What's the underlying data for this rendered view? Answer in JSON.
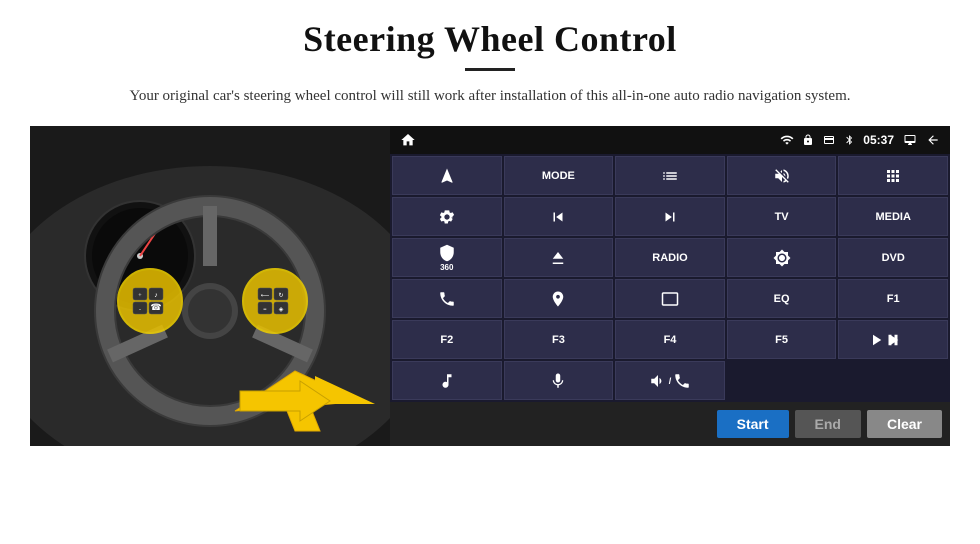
{
  "header": {
    "title": "Steering Wheel Control",
    "subtitle": "Your original car's steering wheel control will still work after installation of this all-in-one auto radio navigation system."
  },
  "status_bar": {
    "time": "05:37",
    "icons": [
      "wifi",
      "lock",
      "card",
      "bluetooth",
      "screen",
      "back"
    ]
  },
  "buttons": [
    {
      "id": "r1c1",
      "type": "icon",
      "icon": "navigate",
      "label": ""
    },
    {
      "id": "r1c2",
      "type": "text",
      "label": "MODE"
    },
    {
      "id": "r1c3",
      "type": "icon",
      "icon": "list",
      "label": ""
    },
    {
      "id": "r1c4",
      "type": "icon",
      "icon": "mute",
      "label": ""
    },
    {
      "id": "r1c5",
      "type": "icon",
      "icon": "apps",
      "label": ""
    },
    {
      "id": "r2c1",
      "type": "icon",
      "icon": "settings",
      "label": ""
    },
    {
      "id": "r2c2",
      "type": "icon",
      "icon": "prev",
      "label": ""
    },
    {
      "id": "r2c3",
      "type": "icon",
      "icon": "next",
      "label": ""
    },
    {
      "id": "r2c4",
      "type": "text",
      "label": "TV"
    },
    {
      "id": "r2c5",
      "type": "text",
      "label": "MEDIA"
    },
    {
      "id": "r3c1",
      "type": "icon",
      "icon": "360cam",
      "label": "360"
    },
    {
      "id": "r3c2",
      "type": "icon",
      "icon": "eject",
      "label": ""
    },
    {
      "id": "r3c3",
      "type": "text",
      "label": "RADIO"
    },
    {
      "id": "r3c4",
      "type": "icon",
      "icon": "brightness",
      "label": ""
    },
    {
      "id": "r3c5",
      "type": "text",
      "label": "DVD"
    },
    {
      "id": "r4c1",
      "type": "icon",
      "icon": "phone",
      "label": ""
    },
    {
      "id": "r4c2",
      "type": "icon",
      "icon": "navi",
      "label": ""
    },
    {
      "id": "r4c3",
      "type": "icon",
      "icon": "screen2",
      "label": ""
    },
    {
      "id": "r4c4",
      "type": "text",
      "label": "EQ"
    },
    {
      "id": "r4c5",
      "type": "text",
      "label": "F1"
    },
    {
      "id": "r5c1",
      "type": "text",
      "label": "F2"
    },
    {
      "id": "r5c2",
      "type": "text",
      "label": "F3"
    },
    {
      "id": "r5c3",
      "type": "text",
      "label": "F4"
    },
    {
      "id": "r5c4",
      "type": "text",
      "label": "F5"
    },
    {
      "id": "r5c5",
      "type": "icon",
      "icon": "playpause",
      "label": ""
    },
    {
      "id": "r6c1",
      "type": "icon",
      "icon": "music",
      "label": ""
    },
    {
      "id": "r6c2",
      "type": "icon",
      "icon": "mic",
      "label": ""
    },
    {
      "id": "r6c3",
      "type": "icon",
      "icon": "vol",
      "label": ""
    },
    {
      "id": "r6c4",
      "type": "empty",
      "label": ""
    },
    {
      "id": "r6c5",
      "type": "empty",
      "label": ""
    }
  ],
  "action_bar": {
    "start_label": "Start",
    "end_label": "End",
    "clear_label": "Clear"
  }
}
